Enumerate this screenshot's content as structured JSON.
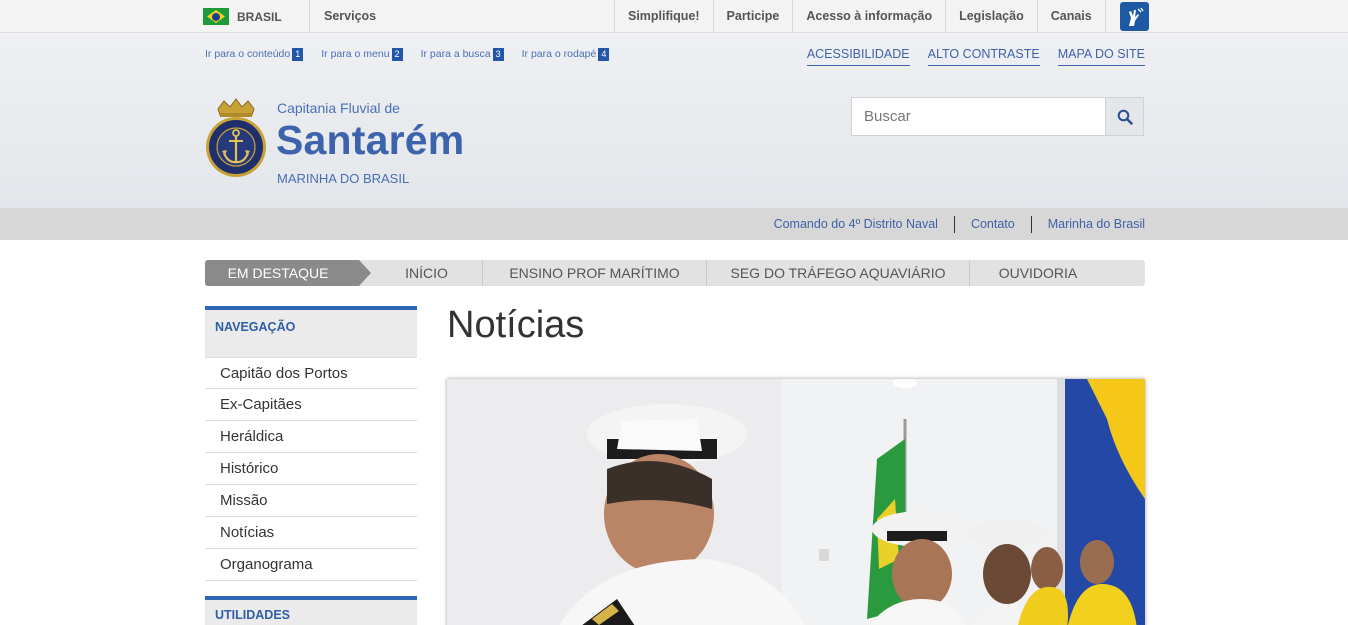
{
  "gov_bar": {
    "country": "BRASIL",
    "services": "Serviços",
    "links": [
      "Simplifique!",
      "Participe",
      "Acesso à informação",
      "Legislação",
      "Canais"
    ]
  },
  "skip_links": [
    {
      "label": "Ir para o conteúdo",
      "key": "1"
    },
    {
      "label": "Ir para o menu",
      "key": "2"
    },
    {
      "label": "Ir para a busca",
      "key": "3"
    },
    {
      "label": "Ir para o rodapé",
      "key": "4"
    }
  ],
  "accessibility_links": [
    "ACESSIBILIDADE",
    "ALTO CONTRASTE",
    "MAPA DO SITE"
  ],
  "site": {
    "subtitle_top": "Capitania Fluvial de",
    "title": "Santarém",
    "subtitle_bottom": "MARINHA DO BRASIL"
  },
  "search": {
    "placeholder": "Buscar"
  },
  "service_links": [
    "Comando do 4º Distrito Naval",
    "Contato",
    "Marinha do Brasil"
  ],
  "main_menu": {
    "active": "EM DESTAQUE",
    "items": [
      "INÍCIO",
      "ENSINO PROF MARÍTIMO",
      "SEG DO TRÁFEGO AQUAVIÁRIO",
      "OUVIDORIA"
    ]
  },
  "sidebar": {
    "heading": "NAVEGAÇÃO",
    "items": [
      "Capitão dos Portos",
      "Ex-Capitães",
      "Heráldica",
      "Histórico",
      "Missão",
      "Notícias",
      "Organograma"
    ],
    "heading_2": "UTILIDADES"
  },
  "content": {
    "title": "Notícias"
  },
  "colors": {
    "brand_blue": "#3d63ad",
    "accent_blue": "#2e67b8",
    "menu_active": "#8a8a8a"
  },
  "icons": {
    "flag": "brazil-flag-icon",
    "vlibras": "vlibras-hands-icon",
    "search": "search-icon",
    "logo": "navy-crest-logo"
  }
}
